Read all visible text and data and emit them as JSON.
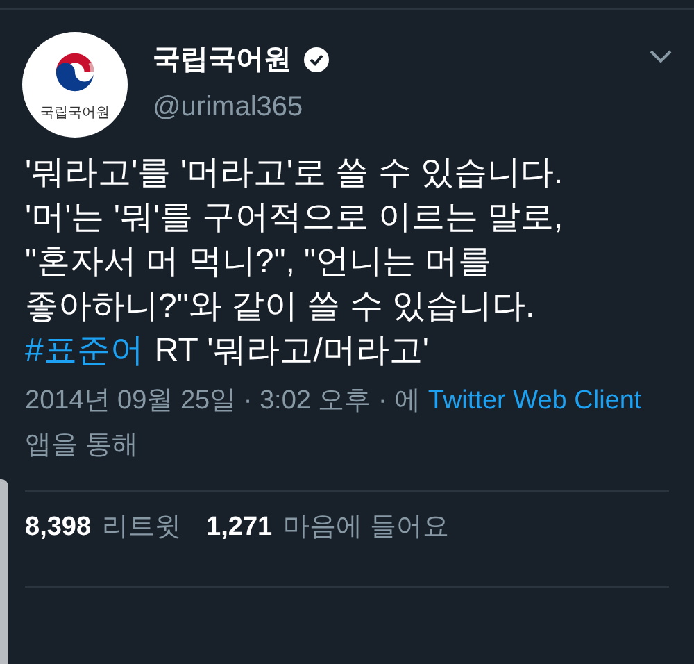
{
  "author": {
    "avatar_text": "국립국어원",
    "name": "국립국어원",
    "verified": true,
    "handle": "@urimal365"
  },
  "tweet": {
    "lines": [
      "'뭐라고'를 '머라고'로 쓸 수 있습니다.",
      "'머'는 '뭐'를 구어적으로 이르는 말로,",
      "\"혼자서 머 먹니?\", \"언니는 머를",
      "좋아하니?\"와 같이 쓸 수 있습니다."
    ],
    "hashtag": "#표준어",
    "rest": "RT '뭐라고/머라고'"
  },
  "meta": {
    "date": "2014년 09월 25일 · 3:02 오후 · 에",
    "client": "Twitter Web Client",
    "suffix": "앱을 통해"
  },
  "stats": [
    {
      "count": "8,398",
      "label": "리트윗"
    },
    {
      "count": "1,271",
      "label": "마음에 들어요"
    }
  ]
}
